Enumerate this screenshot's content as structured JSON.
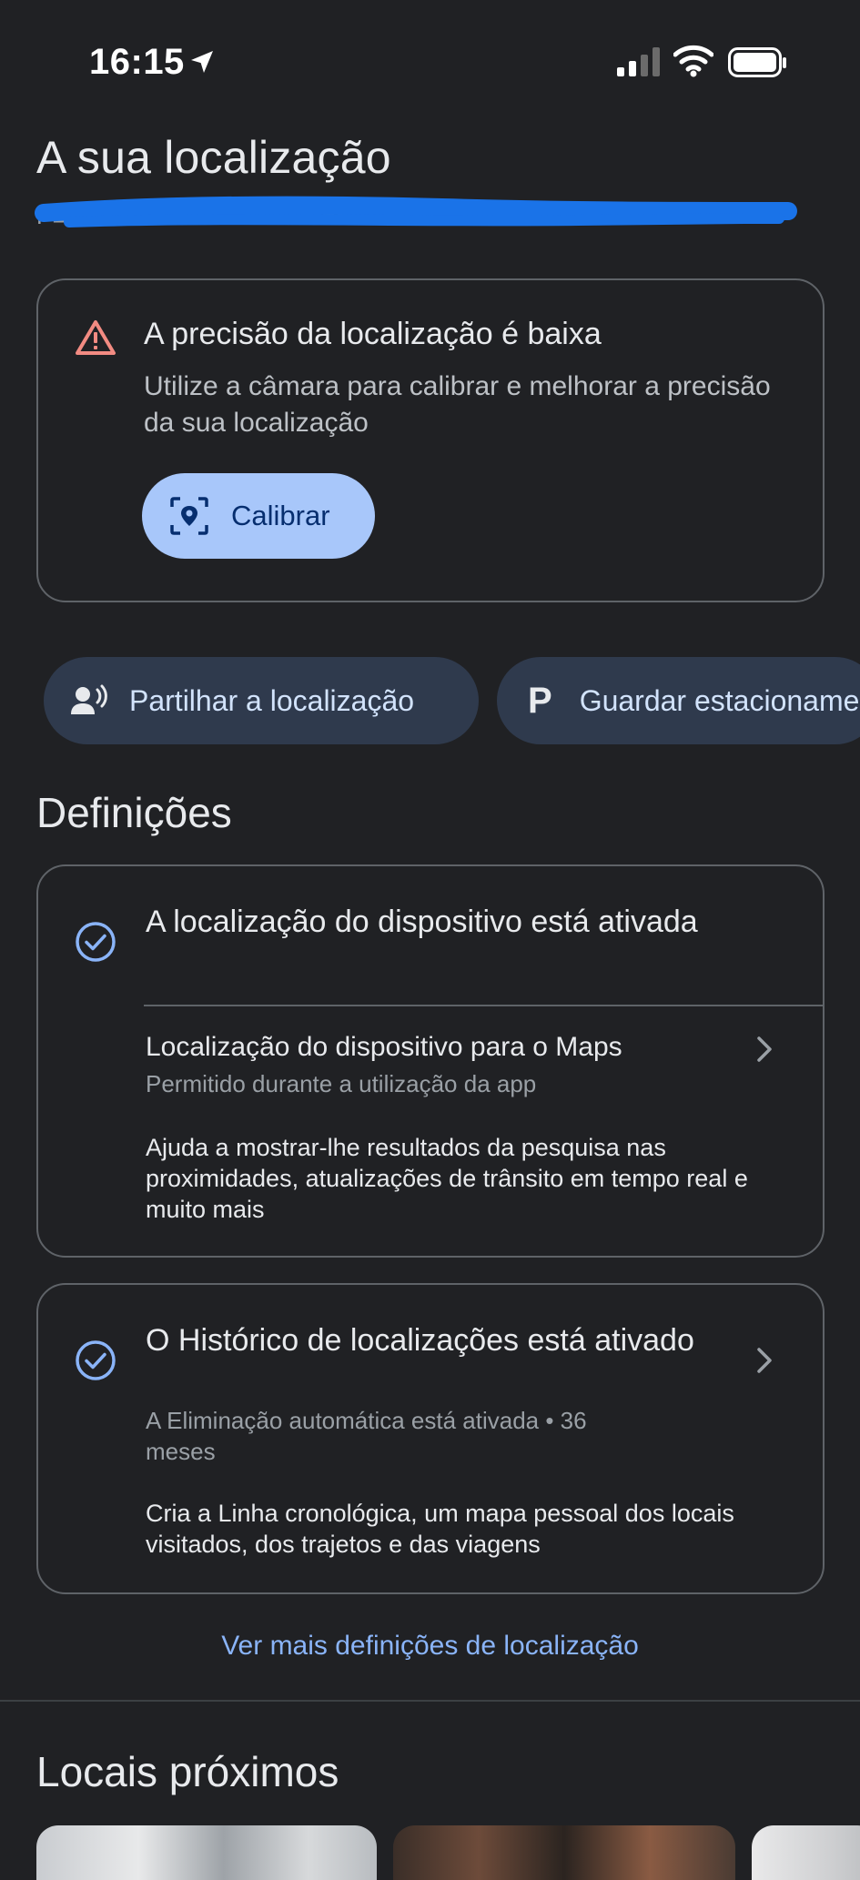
{
  "status_bar": {
    "time": "16:15",
    "icons": [
      "location-arrow-icon",
      "cellular-signal-icon",
      "wifi-icon",
      "battery-icon"
    ]
  },
  "header": {
    "title": "A sua localização",
    "address_redacted": "P■■■ ■■ ■■■■■ ■■ ■■■■■■■■■■■■■■ ■■■■ ■■■■■"
  },
  "accuracy_card": {
    "title": "A precisão da localização é baixa",
    "description": "Utilize a câmara para calibrar e melhorar a precisão da sua localização",
    "calibrate_label": "Calibrar",
    "warning_color": "#f28b82"
  },
  "chips": {
    "share_label": "Partilhar a localização",
    "park_letter": "P",
    "park_label": "Guardar estacionamento"
  },
  "settings": {
    "title": "Definições",
    "device": {
      "title": "A localização do dispositivo está ativada",
      "maps_label": "Localização do dispositivo para o Maps",
      "maps_sub": "Permitido durante a utilização da app",
      "help": "Ajuda a mostrar-lhe resultados da pesquisa nas proximidades, atualizações de trânsito em tempo real e muito mais"
    },
    "history": {
      "title": "O Histórico de localizações está ativado",
      "sub": "A Eliminação automática está ativada • 36 meses",
      "help": "Cria a Linha cronológica, um mapa pessoal dos locais visitados, dos trajetos e das viagens"
    },
    "more_link": "Ver mais definições de localização"
  },
  "nearby": {
    "title": "Locais próximos"
  },
  "colors": {
    "background": "#202124",
    "accent_blue": "#8ab4f8",
    "button_blue": "#a8c7fa",
    "chip_bg": "#2f3a4d",
    "redaction_blue": "#1a73e8"
  }
}
